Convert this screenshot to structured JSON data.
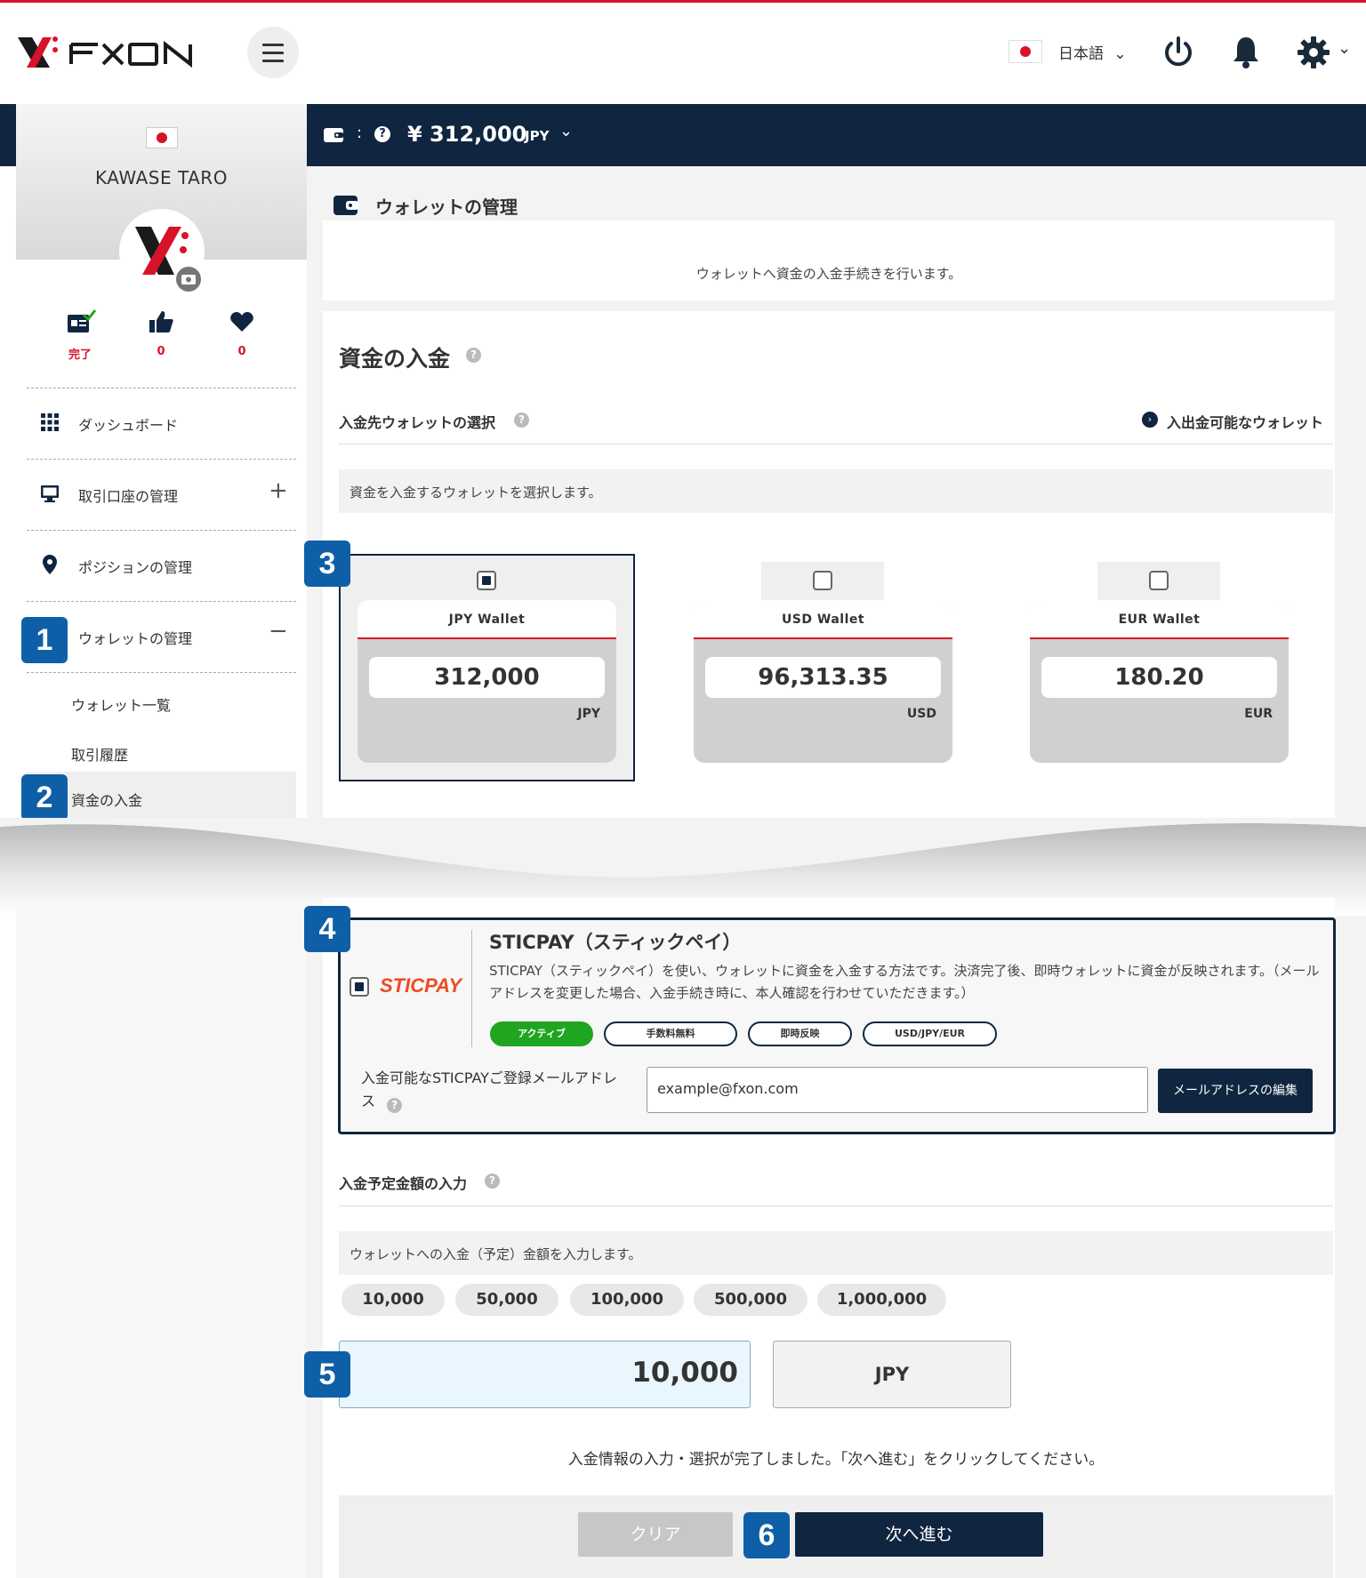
{
  "colors": {
    "brand_red": "#d7132a",
    "navy": "#0f2540",
    "badge_blue": "#0e5fa8",
    "active_green": "#1fa51f"
  },
  "header": {
    "language": "日本語",
    "icons": [
      "hamburger-menu-icon",
      "flag-japan-icon",
      "power-icon",
      "bell-icon",
      "gear-icon"
    ]
  },
  "sidebar": {
    "user_name": "KAWASE TARO",
    "stats": [
      {
        "icon": "id-card-check-icon",
        "value": "完了"
      },
      {
        "icon": "thumbs-up-icon",
        "value": "0"
      },
      {
        "icon": "heart-icon",
        "value": "0"
      }
    ],
    "nav": [
      {
        "label": "ダッシュボード",
        "icon": "grid-icon"
      },
      {
        "label": "取引口座の管理",
        "icon": "monitor-icon",
        "toggle": "+"
      },
      {
        "label": "ポジションの管理",
        "icon": "map-pin-icon"
      },
      {
        "label": "ウォレットの管理",
        "toggle": "−"
      }
    ],
    "sub_nav": [
      "ウォレット一覧",
      "取引履歴",
      "資金の入金"
    ]
  },
  "balance_bar": {
    "separator": ":",
    "amount": "¥ 312,000",
    "currency": "JPY"
  },
  "page": {
    "title": "ウォレットの管理",
    "intro": "ウォレットへ資金の入金手続きを行います。",
    "section_title": "資金の入金",
    "wallet_select": {
      "title": "入金先ウォレットの選択",
      "link": "入出金可能なウォレット",
      "hint": "資金を入金するウォレットを選択します。",
      "wallets": [
        {
          "name": "JPY Wallet",
          "balance": "312,000",
          "currency": "JPY",
          "selected": true
        },
        {
          "name": "USD Wallet",
          "balance": "96,313.35",
          "currency": "USD",
          "selected": false
        },
        {
          "name": "EUR Wallet",
          "balance": "180.20",
          "currency": "EUR",
          "selected": false
        }
      ]
    },
    "sticpay": {
      "logo": "STICPAY",
      "title": "STICPAY（スティックペイ）",
      "description": "STICPAY（スティックペイ）を使い、ウォレットに資金を入金する方法です。決済完了後、即時ウォレットに資金が反映されます。（メールアドレスを変更した場合、入金手続き時に、本人確認を行わせていただきます。）",
      "tags": [
        "アクティブ",
        "手数料無料",
        "即時反映",
        "USD/JPY/EUR"
      ],
      "email_label": "入金可能なSTICPAYご登録メールアドレス",
      "email_value": "example@fxon.com",
      "edit_button": "メールアドレスの編集"
    },
    "amount": {
      "title": "入金予定金額の入力",
      "hint": "ウォレットへの入金（予定）金額を入力します。",
      "presets": [
        "10,000",
        "50,000",
        "100,000",
        "500,000",
        "1,000,000"
      ],
      "value": "10,000",
      "currency": "JPY"
    },
    "completion_message": "入金情報の入力・選択が完了しました。「次へ進む」をクリックしてください。",
    "buttons": {
      "clear": "クリア",
      "next": "次へ進む"
    },
    "steps": [
      "1",
      "2",
      "3",
      "4",
      "5",
      "6"
    ]
  }
}
